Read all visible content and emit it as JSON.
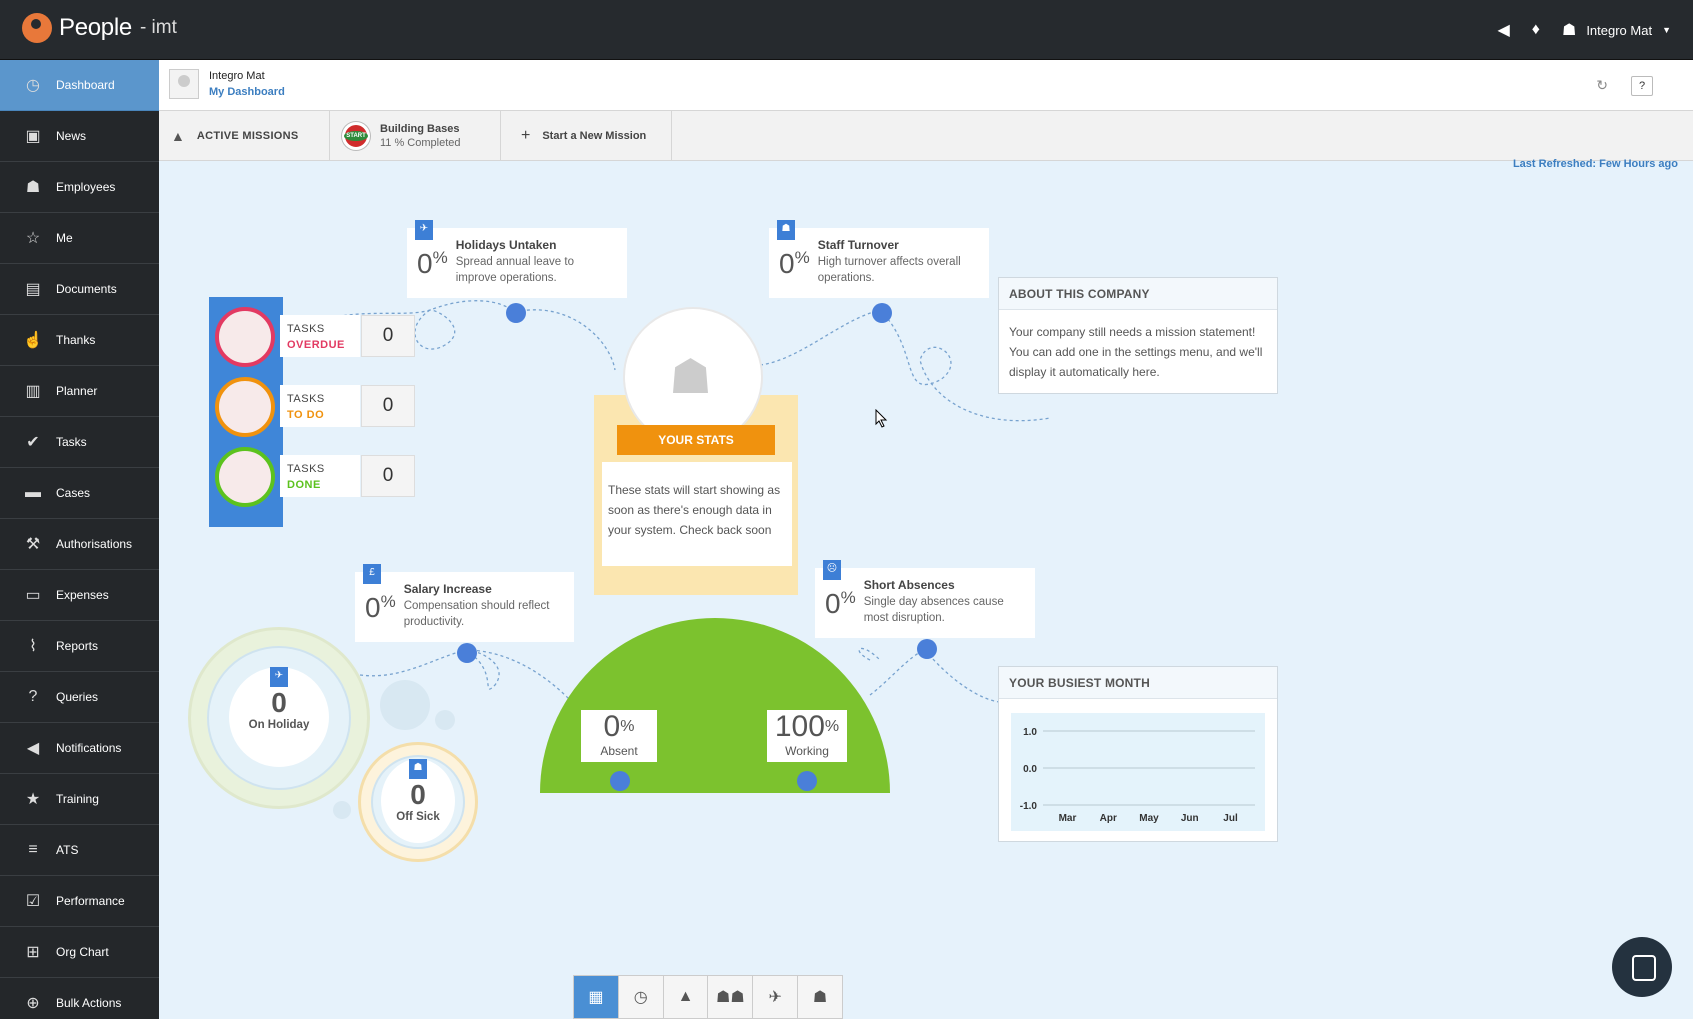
{
  "app": {
    "brand": "People",
    "org": "- imt"
  },
  "topbar": {
    "user": "Integro Mat",
    "icons": [
      "megaphone-icon",
      "bulb-icon",
      "user-icon"
    ]
  },
  "sidebar": {
    "items": [
      {
        "label": "Dashboard",
        "icon": "dashboard-icon",
        "glyph": "◷"
      },
      {
        "label": "News",
        "icon": "tv-icon",
        "glyph": "▣"
      },
      {
        "label": "Employees",
        "icon": "people-icon",
        "glyph": "☗"
      },
      {
        "label": "Me",
        "icon": "user-star-icon",
        "glyph": "☆"
      },
      {
        "label": "Documents",
        "icon": "documents-icon",
        "glyph": "▤"
      },
      {
        "label": "Thanks",
        "icon": "thumbs-up-icon",
        "glyph": "☝"
      },
      {
        "label": "Planner",
        "icon": "planner-icon",
        "glyph": "▥"
      },
      {
        "label": "Tasks",
        "icon": "check-icon",
        "glyph": "✔"
      },
      {
        "label": "Cases",
        "icon": "folder-icon",
        "glyph": "▬"
      },
      {
        "label": "Authorisations",
        "icon": "gavel-icon",
        "glyph": "⚒"
      },
      {
        "label": "Expenses",
        "icon": "wallet-icon",
        "glyph": "▭"
      },
      {
        "label": "Reports",
        "icon": "chart-icon",
        "glyph": "⌇"
      },
      {
        "label": "Queries",
        "icon": "question-doc-icon",
        "glyph": "?"
      },
      {
        "label": "Notifications",
        "icon": "megaphone-icon",
        "glyph": "◀"
      },
      {
        "label": "Training",
        "icon": "star-icon",
        "glyph": "★"
      },
      {
        "label": "ATS",
        "icon": "list-icon",
        "glyph": "≡"
      },
      {
        "label": "Performance",
        "icon": "check-square-icon",
        "glyph": "☑"
      },
      {
        "label": "Org Chart",
        "icon": "org-chart-icon",
        "glyph": "⊞"
      },
      {
        "label": "Bulk Actions",
        "icon": "globe-icon",
        "glyph": "⊕"
      }
    ]
  },
  "header": {
    "name": "Integro Mat",
    "sub": "My Dashboard",
    "help": "?"
  },
  "missions": {
    "active_label": "ACTIVE MISSIONS",
    "mission_title": "Building Bases",
    "mission_progress": "11 % Completed",
    "badge_text": "START",
    "new_mission": "Start a New Mission"
  },
  "last_refreshed": "Last Refreshed: Few Hours ago",
  "tasks": [
    {
      "l1": "TASKS",
      "l2": "OVERDUE",
      "value": "0",
      "color": "#e23a62"
    },
    {
      "l1": "TASKS",
      "l2": "TO DO",
      "value": "0",
      "color": "#f0920e"
    },
    {
      "l1": "TASKS",
      "l2": "DONE",
      "value": "0",
      "color": "#5cc21e"
    }
  ],
  "stats": {
    "holidays": {
      "pct": "0",
      "unit": "%",
      "title": "Holidays Untaken",
      "desc": "Spread annual leave to improve operations."
    },
    "turnover": {
      "pct": "0",
      "unit": "%",
      "title": "Staff Turnover",
      "desc": "High turnover affects overall operations."
    },
    "salary": {
      "pct": "0",
      "unit": "%",
      "title": "Salary Increase",
      "desc": "Compensation should reflect productivity."
    },
    "absences": {
      "pct": "0",
      "unit": "%",
      "title": "Short Absences",
      "desc": "Single day absences cause most disruption."
    }
  },
  "your_stats": {
    "ribbon": "YOUR STATS",
    "text": "These stats will start showing as soon as there's enough data in your system. Check back soon"
  },
  "dome": {
    "absent": {
      "value": "0",
      "unit": "%",
      "label": "Absent"
    },
    "working": {
      "value": "100",
      "unit": "%",
      "label": "Working"
    }
  },
  "holiday_ring": {
    "value": "0",
    "label": "On Holiday"
  },
  "sick_ring": {
    "value": "0",
    "label": "Off Sick"
  },
  "about": {
    "title": "ABOUT THIS COMPANY",
    "text": "Your company still needs a mission statement! You can add one in the settings menu, and we'll display it automatically here."
  },
  "busiest": {
    "title": "YOUR BUSIEST MONTH",
    "chart_data": {
      "type": "line",
      "categories": [
        "Mar",
        "Apr",
        "May",
        "Jun",
        "Jul"
      ],
      "y_ticks": [
        "1.0",
        "0.0",
        "-1.0"
      ],
      "ylim": [
        -1.0,
        1.0
      ],
      "series": []
    }
  },
  "bottom_toolbar": [
    "grid-icon",
    "clock-icon",
    "rocket-icon",
    "group-icon",
    "plane-icon",
    "user-icon"
  ]
}
